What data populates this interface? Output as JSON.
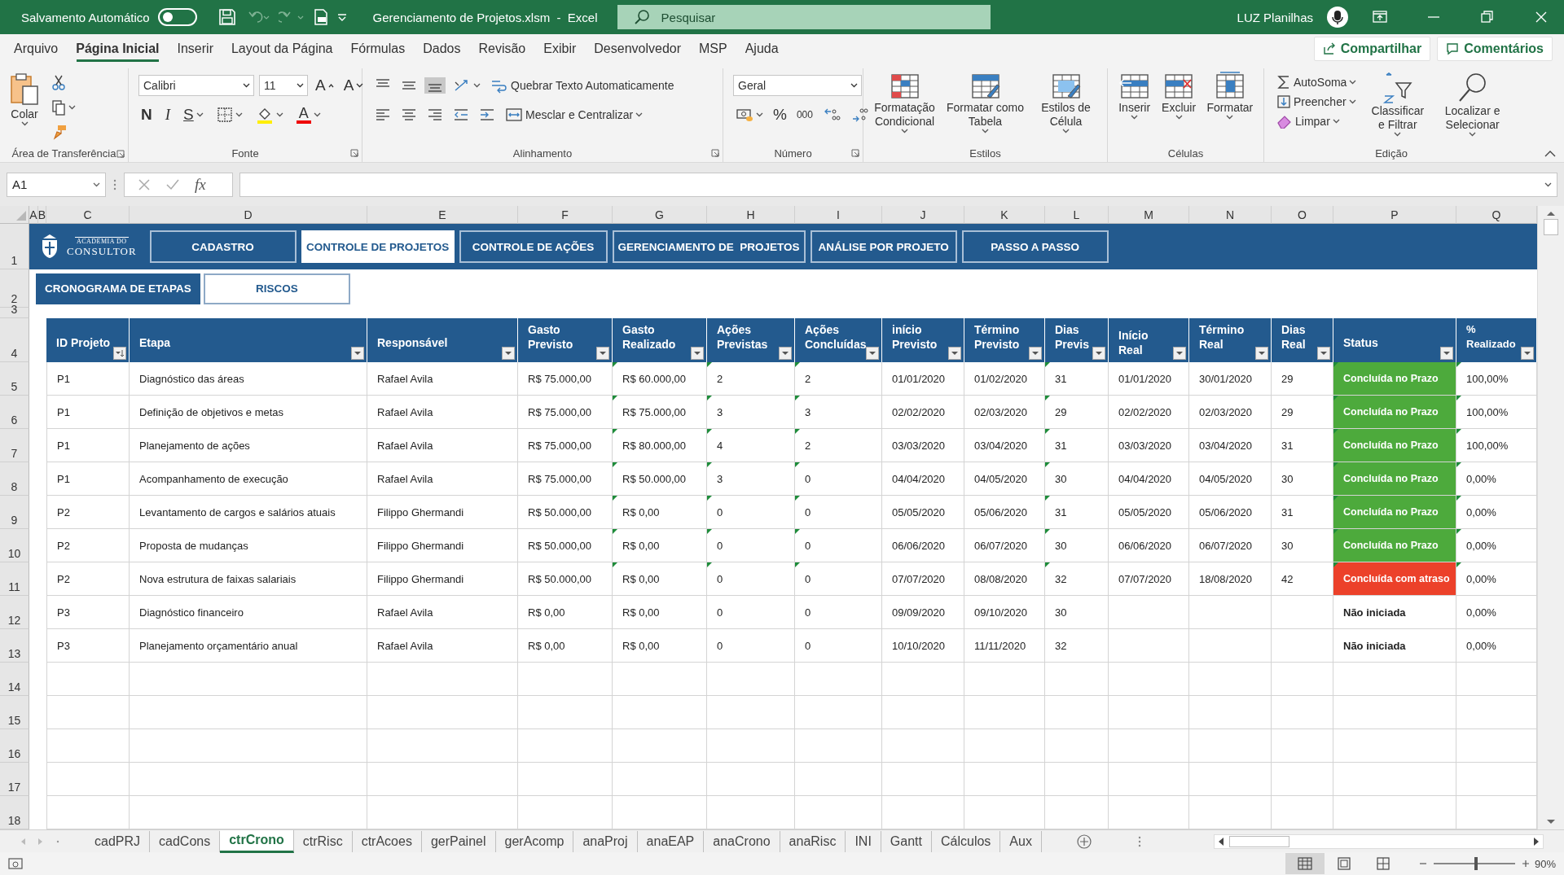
{
  "title_bar": {
    "autosave_label": "Salvamento Automático",
    "autosave_on": false,
    "document_title": "Gerenciamento de Projetos.xlsm  -  Excel",
    "search": {
      "placeholder": "Pesquisar"
    },
    "user_name": "LUZ Planilhas"
  },
  "menu_tabs": [
    {
      "label": "Arquivo",
      "selected": false
    },
    {
      "label": "Página Inicial",
      "selected": true
    },
    {
      "label": "Inserir",
      "selected": false
    },
    {
      "label": "Layout da Página",
      "selected": false
    },
    {
      "label": "Fórmulas",
      "selected": false
    },
    {
      "label": "Dados",
      "selected": false
    },
    {
      "label": "Revisão",
      "selected": false
    },
    {
      "label": "Exibir",
      "selected": false
    },
    {
      "label": "Desenvolvedor",
      "selected": false
    },
    {
      "label": "MSP",
      "selected": false
    },
    {
      "label": "Ajuda",
      "selected": false
    }
  ],
  "share_button": "Compartilhar",
  "comments_button": "Comentários",
  "ribbon": {
    "clipboard": {
      "paste": "Colar",
      "group": "Área de Transferência"
    },
    "font": {
      "name": "Calibri",
      "size": "11",
      "grow": "A",
      "shrink": "A",
      "bold": "N",
      "italic": "I",
      "underline": "S",
      "color_letter": "A",
      "group": "Fonte"
    },
    "alignment": {
      "vertical": [
        {
          "selected": false
        },
        {
          "selected": false
        },
        {
          "selected": true
        }
      ],
      "wrap": "Quebrar Texto Automaticamente",
      "merge": "Mesclar e Centralizar",
      "group": "Alinhamento"
    },
    "number": {
      "format": "Geral",
      "percent": "%",
      "thousands": "000",
      "group": "Número"
    },
    "styles": {
      "buttons": [
        "Formatação Condicional",
        "Formatar como Tabela",
        "Estilos de Célula"
      ],
      "group": "Estilos"
    },
    "cells": {
      "buttons": [
        "Inserir",
        "Excluir",
        "Formatar"
      ],
      "group": "Células"
    },
    "editing": {
      "small": [
        "AutoSoma",
        "Preencher",
        "Limpar"
      ],
      "large": [
        "Classificar e Filtrar",
        "Localizar e Selecionar"
      ],
      "group": "Edição"
    }
  },
  "formula_bar": {
    "name_box": "A1",
    "fx": "fx"
  },
  "columns": [
    "A",
    "B",
    "C",
    "D",
    "E",
    "F",
    "G",
    "H",
    "I",
    "J",
    "K",
    "L",
    "M",
    "N",
    "O",
    "P",
    "Q"
  ],
  "row_numbers": [
    "1",
    "2",
    "3",
    "4",
    "5",
    "6",
    "7",
    "8",
    "9",
    "10",
    "11",
    "12",
    "13",
    "14",
    "15",
    "16",
    "17",
    "18"
  ],
  "logo": {
    "top": "ACADEMIA DO",
    "name": "CONSULTOR"
  },
  "nav_buttons": [
    {
      "label": "CADASTRO",
      "selected": false
    },
    {
      "label": "CONTROLE DE PROJETOS",
      "selected": true
    },
    {
      "label": "CONTROLE DE AÇÕES",
      "selected": false
    },
    {
      "label": "GERENCIAMENTO DE  PROJETOS",
      "selected": false
    },
    {
      "label": "ANÁLISE POR PROJETO",
      "selected": false
    },
    {
      "label": "PASSO A PASSO",
      "selected": false
    }
  ],
  "sub_buttons": [
    {
      "label": "CRONOGRAMA DE ETAPAS",
      "selected": true
    },
    {
      "label": "RISCOS",
      "selected": false
    }
  ],
  "table": {
    "headers": [
      {
        "label": "ID Projeto",
        "sorted": true
      },
      {
        "label": "Etapa",
        "sorted": false
      },
      {
        "label": "Responsável",
        "sorted": false
      },
      {
        "label": "Gasto Previsto",
        "sorted": false
      },
      {
        "label": "Gasto Realizado",
        "sorted": false
      },
      {
        "label": "Ações Previstas",
        "sorted": false
      },
      {
        "label": "Ações Concluídas",
        "sorted": false
      },
      {
        "label": "início Previsto",
        "sorted": false
      },
      {
        "label": "Término Previsto",
        "sorted": false
      },
      {
        "label": "Dias Previs",
        "sorted": false
      },
      {
        "label": "Início Real",
        "sorted": false
      },
      {
        "label": "Término Real",
        "sorted": false
      },
      {
        "label": "Dias Real",
        "sorted": false
      },
      {
        "label": "Status",
        "sorted": false
      },
      {
        "label": "% Realizado",
        "sorted": false
      }
    ],
    "rows": [
      {
        "cells": [
          "P1",
          "Diagnóstico das áreas",
          "Rafael Avila",
          "R$ 75.000,00",
          "R$ 60.000,00",
          "2",
          "2",
          "01/01/2020",
          "01/02/2020",
          "31",
          "01/01/2020",
          "30/01/2020",
          "29"
        ],
        "status": {
          "text": "Concluída no Prazo",
          "kind": "on_time"
        },
        "realizado": "100,00%",
        "error_marks": true
      },
      {
        "cells": [
          "P1",
          "Definição de objetivos e metas",
          "Rafael Avila",
          "R$ 75.000,00",
          "R$ 75.000,00",
          "3",
          "3",
          "02/02/2020",
          "02/03/2020",
          "29",
          "02/02/2020",
          "02/03/2020",
          "29"
        ],
        "status": {
          "text": "Concluída no Prazo",
          "kind": "on_time"
        },
        "realizado": "100,00%",
        "error_marks": true
      },
      {
        "cells": [
          "P1",
          "Planejamento de ações",
          "Rafael Avila",
          "R$ 75.000,00",
          "R$ 80.000,00",
          "4",
          "2",
          "03/03/2020",
          "03/04/2020",
          "31",
          "03/03/2020",
          "03/04/2020",
          "31"
        ],
        "status": {
          "text": "Concluída no Prazo",
          "kind": "on_time"
        },
        "realizado": "100,00%",
        "error_marks": true
      },
      {
        "cells": [
          "P1",
          "Acompanhamento de execução",
          "Rafael Avila",
          "R$ 75.000,00",
          "R$ 50.000,00",
          "3",
          "0",
          "04/04/2020",
          "04/05/2020",
          "30",
          "04/04/2020",
          "04/05/2020",
          "30"
        ],
        "status": {
          "text": "Concluída no Prazo",
          "kind": "on_time"
        },
        "realizado": "0,00%",
        "error_marks": true
      },
      {
        "cells": [
          "P2",
          "Levantamento de cargos e salários atuais",
          "Filippo Ghermandi",
          "R$ 50.000,00",
          "R$ 0,00",
          "0",
          "0",
          "05/05/2020",
          "05/06/2020",
          "31",
          "05/05/2020",
          "05/06/2020",
          "31"
        ],
        "status": {
          "text": "Concluída no Prazo",
          "kind": "on_time"
        },
        "realizado": "0,00%",
        "error_marks": true
      },
      {
        "cells": [
          "P2",
          "Proposta de mudanças",
          "Filippo Ghermandi",
          "R$ 50.000,00",
          "R$ 0,00",
          "0",
          "0",
          "06/06/2020",
          "06/07/2020",
          "30",
          "06/06/2020",
          "06/07/2020",
          "30"
        ],
        "status": {
          "text": "Concluída no Prazo",
          "kind": "on_time"
        },
        "realizado": "0,00%",
        "error_marks": true
      },
      {
        "cells": [
          "P2",
          "Nova estrutura de faixas salariais",
          "Filippo Ghermandi",
          "R$ 50.000,00",
          "R$ 0,00",
          "0",
          "0",
          "07/07/2020",
          "08/08/2020",
          "32",
          "07/07/2020",
          "18/08/2020",
          "42"
        ],
        "status": {
          "text": "Concluída com atraso",
          "kind": "late"
        },
        "realizado": "0,00%",
        "error_marks": true
      },
      {
        "cells": [
          "P3",
          "Diagnóstico financeiro",
          "Rafael Avila",
          "R$ 0,00",
          "R$ 0,00",
          "0",
          "0",
          "09/09/2020",
          "09/10/2020",
          "30",
          null,
          null,
          null
        ],
        "status": {
          "text": "Não iniciada",
          "kind": "not_started"
        },
        "realizado": "0,00%",
        "error_marks": false
      },
      {
        "cells": [
          "P3",
          "Planejamento orçamentário anual",
          "Rafael Avila",
          "R$ 0,00",
          "R$ 0,00",
          "0",
          "0",
          "10/10/2020",
          "11/11/2020",
          "32",
          null,
          null,
          null
        ],
        "status": {
          "text": "Não iniciada",
          "kind": "not_started"
        },
        "realizado": "0,00%",
        "error_marks": false
      }
    ]
  },
  "sheet_tabs": [
    {
      "label": "cadPRJ",
      "selected": false
    },
    {
      "label": "cadCons",
      "selected": false
    },
    {
      "label": "ctrCrono",
      "selected": true
    },
    {
      "label": "ctrRisc",
      "selected": false
    },
    {
      "label": "ctrAcoes",
      "selected": false
    },
    {
      "label": "gerPainel",
      "selected": false
    },
    {
      "label": "gerAcomp",
      "selected": false
    },
    {
      "label": "anaProj",
      "selected": false
    },
    {
      "label": "anaEAP",
      "selected": false
    },
    {
      "label": "anaCrono",
      "selected": false
    },
    {
      "label": "anaRisc",
      "selected": false
    },
    {
      "label": "INI",
      "selected": false
    },
    {
      "label": "Gantt",
      "selected": false
    },
    {
      "label": "Cálculos",
      "selected": false
    },
    {
      "label": "Aux",
      "selected": false
    }
  ],
  "status_bar": {
    "views": [
      {
        "selected": true
      },
      {
        "selected": false
      },
      {
        "selected": false
      }
    ],
    "zoom_slider": {
      "level": 0.5
    },
    "zoom": "90%"
  }
}
